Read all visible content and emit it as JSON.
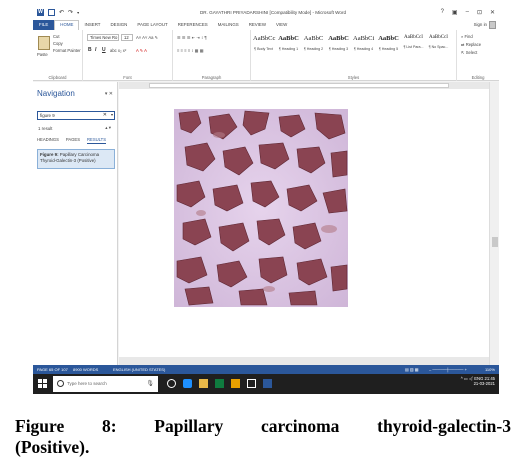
{
  "window": {
    "title": "DR. GAYATHRI PRIYADARSHINI [Compatibility Mode] - Microsoft Word",
    "controls": [
      "?",
      "▣",
      "–",
      "⊡",
      "✕"
    ]
  },
  "ribbon_tabs": [
    "FILE",
    "HOME",
    "INSERT",
    "DESIGN",
    "PAGE LAYOUT",
    "REFERENCES",
    "MAILINGS",
    "REVIEW",
    "VIEW"
  ],
  "sign_in": "Sign in",
  "clipboard": {
    "paste": "Paste",
    "cut": "Cut",
    "copy": "Copy",
    "format_painter": "Format Painter",
    "label": "Clipboard"
  },
  "font": {
    "name": "Times New Ro",
    "size": "12",
    "label": "Font"
  },
  "paragraph": {
    "label": "Paragraph"
  },
  "styles": {
    "label": "Styles",
    "items": [
      {
        "sample": "AaBbCc",
        "name": "¶ Body Text"
      },
      {
        "sample": "AaBbC",
        "name": "¶ Heading 1"
      },
      {
        "sample": "AaBbC",
        "name": "¶ Heading 2"
      },
      {
        "sample": "AaBbC",
        "name": "¶ Heading 3"
      },
      {
        "sample": "AaBbCi",
        "name": "¶ Heading 4"
      },
      {
        "sample": "AaBbC",
        "name": "¶ Heading 5"
      },
      {
        "sample": "AaBbCcI",
        "name": "¶ List Para..."
      },
      {
        "sample": "AaBbCcI",
        "name": "¶ No Spac..."
      }
    ]
  },
  "editing": {
    "find": "Find",
    "replace": "Replace",
    "select": "Select",
    "label": "Editing"
  },
  "navigation": {
    "title": "Navigation",
    "search_value": "figure 9",
    "result_count": "1 result",
    "tabs": [
      "HEADINGS",
      "PAGES",
      "RESULTS"
    ],
    "active_tab": "RESULTS",
    "hit_bold": "Figure 9:",
    "hit_text": " Papillary Carcinoma Thyroid-Galectin-3 (Positive)"
  },
  "status_bar": {
    "page": "PAGE 65 OF 107",
    "words": "8900 WORDS",
    "language": "ENGLISH (UNITED STATES)",
    "zoom": "110%"
  },
  "taskbar": {
    "search_placeholder": "Type here to search",
    "time": "21:45",
    "date": "21-03-2021"
  },
  "caption": {
    "line1": "Figure 8: Papillary carcinoma thyroid-galectin-3",
    "line2": "(Positive)."
  },
  "colors": {
    "word_blue": "#2b579a",
    "taskbar": "#1f1f1f",
    "tissue_bg": "#ddc8e4",
    "tissue_stain": "#7a3540"
  }
}
